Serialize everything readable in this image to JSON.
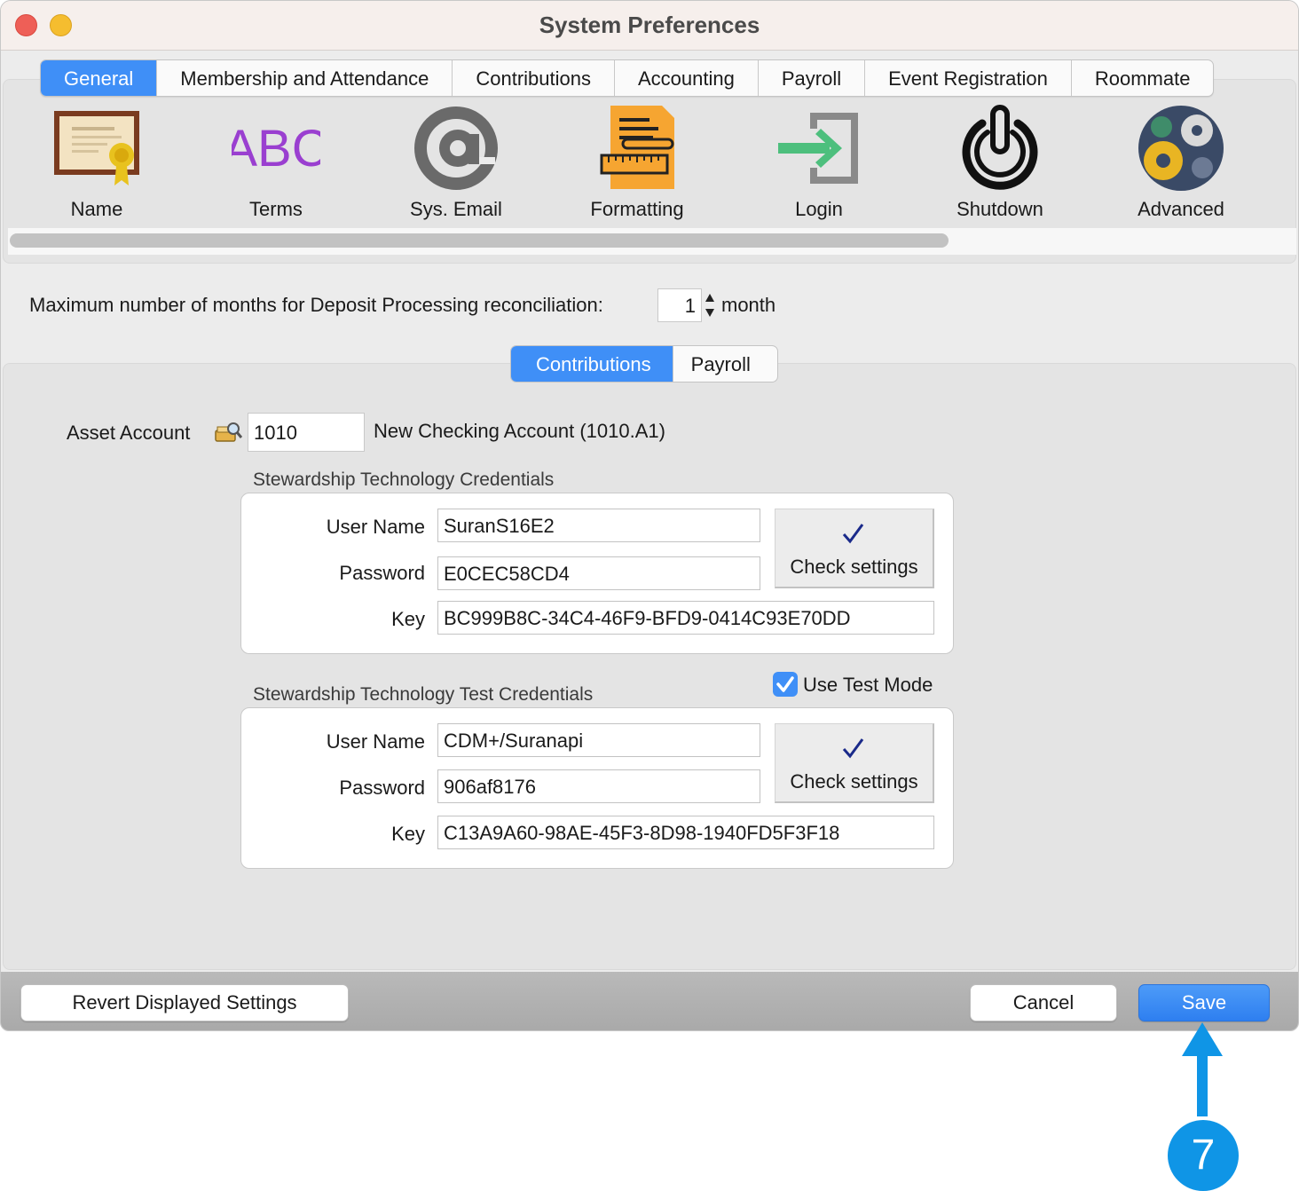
{
  "window": {
    "title": "System Preferences"
  },
  "tabs": [
    {
      "label": "General",
      "active": true
    },
    {
      "label": "Membership and Attendance",
      "active": false
    },
    {
      "label": "Contributions",
      "active": false
    },
    {
      "label": "Accounting",
      "active": false
    },
    {
      "label": "Payroll",
      "active": false
    },
    {
      "label": "Event Registration",
      "active": false
    },
    {
      "label": "Roommate",
      "active": false
    }
  ],
  "toolbar": {
    "items": [
      {
        "label": "Name",
        "icon": "certificate-icon"
      },
      {
        "label": "Terms",
        "icon": "abc-icon"
      },
      {
        "label": "Sys. Email",
        "icon": "at-sign-icon"
      },
      {
        "label": "Formatting",
        "icon": "formatting-icon"
      },
      {
        "label": "Login",
        "icon": "login-icon"
      },
      {
        "label": "Shutdown",
        "icon": "power-icon"
      },
      {
        "label": "Advanced",
        "icon": "gears-icon"
      }
    ]
  },
  "deposit": {
    "label": "Maximum number of months for Deposit Processing reconciliation:",
    "value": "1",
    "unit": "month"
  },
  "subtabs": [
    {
      "label": "Contributions",
      "active": true
    },
    {
      "label": "Payroll",
      "active": false
    }
  ],
  "asset": {
    "label": "Asset Account",
    "value": "1010",
    "description": "New Checking Account (1010.A1)"
  },
  "credentials": {
    "title": "Stewardship Technology Credentials",
    "user_name_label": "User Name",
    "user_name": "SuranS16E2",
    "password_label": "Password",
    "password": "E0CEC58CD4",
    "key_label": "Key",
    "key": "BC999B8C-34C4-46F9-BFD9-0414C93E70DD",
    "check_label": "Check settings"
  },
  "test_credentials": {
    "title": "Stewardship Technology Test Credentials",
    "use_test_mode_label": "Use Test Mode",
    "use_test_mode": true,
    "user_name_label": "User Name",
    "user_name": "CDM+/Suranapi",
    "password_label": "Password",
    "password": "906af8176",
    "key_label": "Key",
    "key": "C13A9A60-98AE-45F3-8D98-1940FD5F3F18",
    "check_label": "Check settings"
  },
  "footer": {
    "revert_label": "Revert Displayed Settings",
    "cancel_label": "Cancel",
    "save_label": "Save"
  },
  "annotation": {
    "step": "7",
    "color": "#0f95e6"
  },
  "colors": {
    "accent": "#3f8ff7",
    "titlebar": "#f6efec"
  }
}
